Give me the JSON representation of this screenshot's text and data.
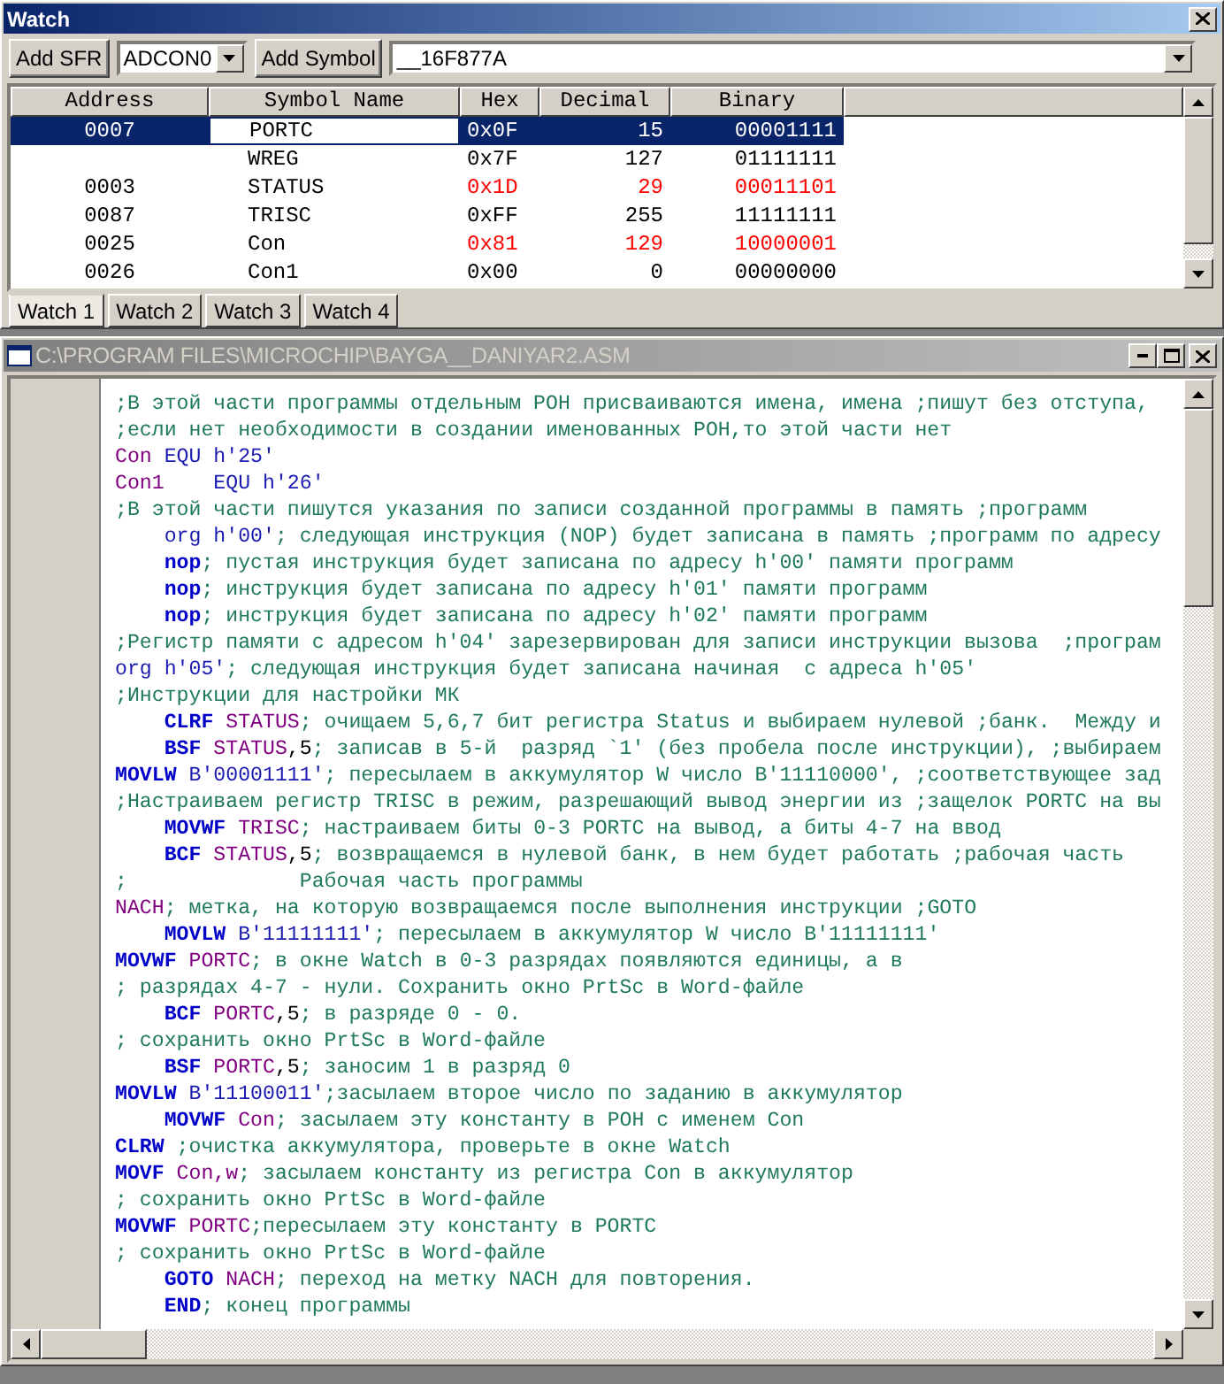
{
  "watch": {
    "title": "Watch",
    "sfr_button": "Add SFR",
    "sfr_select": "ADCON0",
    "symbol_button": "Add Symbol",
    "symbol_select": "__16F877A",
    "columns": [
      "Address",
      "Symbol Name",
      "Hex",
      "Decimal",
      "Binary"
    ],
    "rows": [
      {
        "address": "0007",
        "symbol": "PORTC",
        "hex": "0x0F",
        "decimal": "15",
        "binary": "00001111",
        "selected": true,
        "changed": false
      },
      {
        "symbol": "WREG",
        "hex": "0x7F",
        "decimal": "127",
        "binary": "01111111",
        "selected": false,
        "changed": false
      },
      {
        "address": "0003",
        "symbol": "STATUS",
        "hex": "0x1D",
        "decimal": "29",
        "binary": "00011101",
        "selected": false,
        "changed": true
      },
      {
        "address": "0087",
        "symbol": "TRISC",
        "hex": "0xFF",
        "decimal": "255",
        "binary": "11111111",
        "selected": false,
        "changed": false
      },
      {
        "address": "0025",
        "symbol": "Con",
        "hex": "0x81",
        "decimal": "129",
        "binary": "10000001",
        "selected": false,
        "changed": true
      },
      {
        "address": "0026",
        "symbol": "Con1",
        "hex": "0x00",
        "decimal": "0",
        "binary": "00000000",
        "selected": false,
        "changed": false
      }
    ],
    "tabs": [
      {
        "label": "Watch 1",
        "selected": true
      },
      {
        "label": "Watch 2",
        "selected": false
      },
      {
        "label": "Watch 3",
        "selected": false
      },
      {
        "label": "Watch 4",
        "selected": false
      }
    ]
  },
  "editor": {
    "title": "C:\\PROGRAM FILES\\MICROCHIP\\BAYGA__DANIYAR2.ASM",
    "lines": [
      {
        "indent": false,
        "tokens": [
          {
            "kind": "comment",
            "text": ";В этой части программы отдельным РОН присваиваются имена, имена ;пишут без отступа,"
          }
        ]
      },
      {
        "indent": false,
        "tokens": [
          {
            "kind": "comment",
            "text": ";если нет необходимости в создании именованных РОН,то этой части нет"
          }
        ]
      },
      {
        "indent": false,
        "tokens": [
          {
            "kind": "symbol",
            "text": "Con"
          },
          {
            "kind": "directive",
            "text": " EQU h'25'"
          }
        ]
      },
      {
        "indent": false,
        "tokens": [
          {
            "kind": "symbol",
            "text": "Con1"
          },
          {
            "kind": "directive",
            "text": "    EQU h'26'"
          }
        ]
      },
      {
        "indent": false,
        "tokens": [
          {
            "kind": "comment",
            "text": ";В этой части пишутся указания по записи созданной программы в память ;программ"
          }
        ]
      },
      {
        "indent": true,
        "tokens": [
          {
            "kind": "directive",
            "text": "org h'00'"
          },
          {
            "kind": "comment",
            "text": "; следующая инструкция (NOP) будет записана в память ;программ по адресу"
          }
        ]
      },
      {
        "indent": true,
        "tokens": [
          {
            "kind": "mnemonic",
            "text": "nop"
          },
          {
            "kind": "comment",
            "text": "; пустая инструкция будет записана по адресу h′00′ памяти программ"
          }
        ]
      },
      {
        "indent": true,
        "tokens": [
          {
            "kind": "mnemonic",
            "text": "nop"
          },
          {
            "kind": "comment",
            "text": "; инструкция будет записана по адресу h′01′ памяти программ"
          }
        ]
      },
      {
        "indent": true,
        "tokens": [
          {
            "kind": "mnemonic",
            "text": "nop"
          },
          {
            "kind": "comment",
            "text": "; инструкция будет записана по адресу h′02′ памяти программ"
          }
        ]
      },
      {
        "indent": false,
        "tokens": [
          {
            "kind": "comment",
            "text": ";Регистр памяти с адресом h'04' зарезервирован для записи инструкции вызова  ;програм"
          }
        ]
      },
      {
        "indent": false,
        "tokens": [
          {
            "kind": "directive",
            "text": "org h'05'"
          },
          {
            "kind": "comment",
            "text": "; следующая инструкция будет записана начиная  с адреса h′05′"
          }
        ]
      },
      {
        "indent": false,
        "tokens": [
          {
            "kind": "comment",
            "text": ";Инструкции для настройки МК"
          }
        ]
      },
      {
        "indent": true,
        "tokens": [
          {
            "kind": "mnemonic",
            "text": "CLRF"
          },
          {
            "kind": "symbol",
            "text": " STATUS"
          },
          {
            "kind": "comment",
            "text": "; очищаем 5,6,7 бит регистра Status и выбираем нулевой ;банк.  Между и"
          }
        ]
      },
      {
        "indent": true,
        "tokens": [
          {
            "kind": "mnemonic",
            "text": "BSF"
          },
          {
            "kind": "symbol",
            "text": " STATUS"
          },
          {
            "kind": "number",
            "text": ",5"
          },
          {
            "kind": "comment",
            "text": "; записав в 5-й  разряд `1′ (без пробела после инструкции), ;выбираем"
          }
        ]
      },
      {
        "indent": false,
        "tokens": [
          {
            "kind": "mnemonic",
            "text": "MOVLW"
          },
          {
            "kind": "directive",
            "text": " B'00001111'"
          },
          {
            "kind": "comment",
            "text": "; пересылаем в аккумулятор W число B′11110000′, ;соответствующее зад"
          }
        ]
      },
      {
        "indent": false,
        "tokens": [
          {
            "kind": "comment",
            "text": ";Настраиваем регистр TRISC в режим, разрешающий вывод энергии из ;защелок PORTC на вы"
          }
        ]
      },
      {
        "indent": true,
        "tokens": [
          {
            "kind": "mnemonic",
            "text": "MOVWF"
          },
          {
            "kind": "symbol",
            "text": " TRISC"
          },
          {
            "kind": "comment",
            "text": "; настраиваем биты 0-3 PORTC на вывод, а биты 4-7 на ввод"
          }
        ]
      },
      {
        "indent": true,
        "tokens": [
          {
            "kind": "mnemonic",
            "text": "BCF"
          },
          {
            "kind": "symbol",
            "text": " STATUS"
          },
          {
            "kind": "number",
            "text": ",5"
          },
          {
            "kind": "comment",
            "text": "; возвращаемся в нулевой банк, в нем будет работать ;рабочая часть"
          }
        ]
      },
      {
        "indent": false,
        "tokens": [
          {
            "kind": "comment",
            "text": ";              Рабочая часть программы"
          }
        ]
      },
      {
        "indent": false,
        "tokens": [
          {
            "kind": "symbol",
            "text": "NACH"
          },
          {
            "kind": "comment",
            "text": "; метка, на которую возвращаемся после выполнения инструкции ;GOTO"
          }
        ]
      },
      {
        "indent": true,
        "tokens": [
          {
            "kind": "mnemonic",
            "text": "MOVLW"
          },
          {
            "kind": "directive",
            "text": " B'11111111'"
          },
          {
            "kind": "comment",
            "text": "; пересылаем в аккумулятор W число B′11111111′"
          }
        ]
      },
      {
        "indent": false,
        "tokens": [
          {
            "kind": "mnemonic",
            "text": "MOVWF"
          },
          {
            "kind": "symbol",
            "text": " PORTC"
          },
          {
            "kind": "comment",
            "text": "; в окне Watch в 0-3 разрядах появляются единицы, а в"
          }
        ]
      },
      {
        "indent": false,
        "tokens": [
          {
            "kind": "comment",
            "text": "; разрядах 4-7 - нули. Сохранить окно PrtSc в Word-файле"
          }
        ]
      },
      {
        "indent": true,
        "tokens": [
          {
            "kind": "mnemonic",
            "text": "BCF"
          },
          {
            "kind": "symbol",
            "text": " PORTC"
          },
          {
            "kind": "number",
            "text": ",5"
          },
          {
            "kind": "comment",
            "text": "; в разряде 0 - 0."
          }
        ]
      },
      {
        "indent": false,
        "tokens": [
          {
            "kind": "comment",
            "text": "; сохранить окно PrtSc в Word-файле"
          }
        ]
      },
      {
        "indent": true,
        "tokens": [
          {
            "kind": "mnemonic",
            "text": "BSF"
          },
          {
            "kind": "symbol",
            "text": " PORTC"
          },
          {
            "kind": "number",
            "text": ",5"
          },
          {
            "kind": "comment",
            "text": "; заносим 1 в разряд 0"
          }
        ]
      },
      {
        "indent": false,
        "tokens": [
          {
            "kind": "mnemonic",
            "text": "MOVLW"
          },
          {
            "kind": "directive",
            "text": " B'11100011'"
          },
          {
            "kind": "comment",
            "text": ";засылаем второе число по заданию в аккумулятор"
          }
        ]
      },
      {
        "indent": true,
        "tokens": [
          {
            "kind": "mnemonic",
            "text": "MOVWF"
          },
          {
            "kind": "symbol",
            "text": " Con"
          },
          {
            "kind": "comment",
            "text": "; засылаем эту константу в РОН с именем Con"
          }
        ]
      },
      {
        "indent": false,
        "tokens": [
          {
            "kind": "mnemonic",
            "text": "CLRW"
          },
          {
            "kind": "comment",
            "text": " ;очистка аккумулятора, проверьте в окне Watch"
          }
        ]
      },
      {
        "indent": false,
        "tokens": [
          {
            "kind": "mnemonic",
            "text": "MOVF"
          },
          {
            "kind": "symbol",
            "text": " Con,w"
          },
          {
            "kind": "comment",
            "text": "; засылаем константу из регистра Con в аккумулятор"
          }
        ]
      },
      {
        "indent": false,
        "tokens": [
          {
            "kind": "comment",
            "text": "; сохранить окно PrtSc в Word-файле"
          }
        ]
      },
      {
        "indent": false,
        "tokens": [
          {
            "kind": "mnemonic",
            "text": "MOVWF"
          },
          {
            "kind": "symbol",
            "text": " PORTC"
          },
          {
            "kind": "comment",
            "text": ";пересылаем эту константу в PORTC"
          }
        ]
      },
      {
        "indent": false,
        "tokens": [
          {
            "kind": "comment",
            "text": "; сохранить окно PrtSc в Word-файле"
          }
        ]
      },
      {
        "indent": true,
        "tokens": [
          {
            "kind": "mnemonic",
            "text": "GOTO"
          },
          {
            "kind": "symbol",
            "text": " NACH"
          },
          {
            "kind": "comment",
            "text": "; переход на метку NACH для повторения."
          }
        ]
      },
      {
        "indent": true,
        "tokens": [
          {
            "kind": "mnemonic",
            "text": "END"
          },
          {
            "kind": "comment",
            "text": "; конец программы"
          }
        ]
      }
    ]
  }
}
